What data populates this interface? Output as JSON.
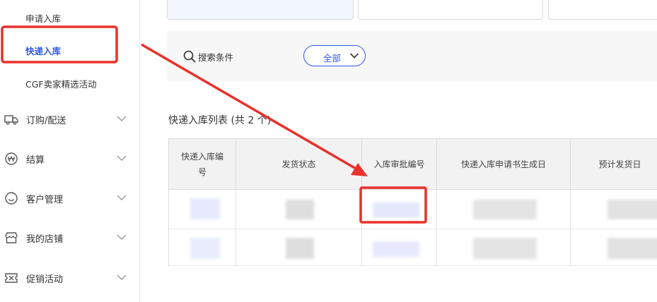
{
  "sidebar": {
    "sub_items": [
      {
        "label": "申请入库",
        "active": false
      },
      {
        "label": "快递入库",
        "active": true
      },
      {
        "label": "CGF卖家精选活动",
        "active": false
      }
    ],
    "nav_items": [
      {
        "label": "订购/配送",
        "icon": "truck-icon"
      },
      {
        "label": "结算",
        "icon": "won-coin-icon"
      },
      {
        "label": "客户管理",
        "icon": "smile-icon"
      },
      {
        "label": "我的店铺",
        "icon": "store-icon"
      },
      {
        "label": "促销活动",
        "icon": "ticket-icon"
      }
    ]
  },
  "filter": {
    "search_label": "搜索条件",
    "select_value": "全部"
  },
  "list": {
    "title": "快递入库列表 (共 2 个)",
    "columns": [
      "快递入库编号",
      "发货状态",
      "入库审批编号",
      "快递入库申请书生成日",
      "预计发货日"
    ]
  },
  "colors": {
    "accent": "#2d59e6",
    "annotation_red": "#e8312b"
  }
}
